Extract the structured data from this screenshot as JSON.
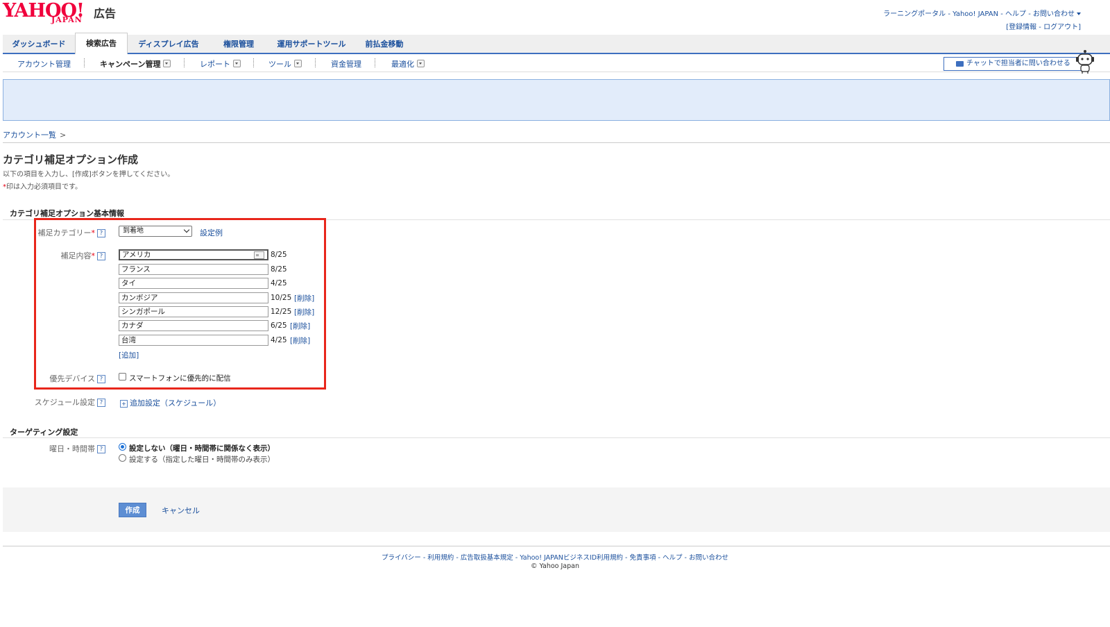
{
  "header": {
    "logo_yahoo": "YAHOO!",
    "logo_japan": "JAPAN",
    "logo_ad": "広告",
    "toplinks": [
      "ラーニングポータル",
      "Yahoo! JAPAN",
      "ヘルプ",
      "お問い合わせ"
    ],
    "account_links": [
      "[登録情報",
      "ログアウト]"
    ],
    "separator": " - "
  },
  "tabs": [
    {
      "label": "ダッシュボード",
      "active": false
    },
    {
      "label": "検索広告",
      "active": true
    },
    {
      "label": "ディスプレイ広告",
      "active": false
    },
    {
      "label": "権限管理",
      "active": false
    },
    {
      "label": "運用サポートツール",
      "active": false
    },
    {
      "label": "前払金移動",
      "active": false
    }
  ],
  "subnav": [
    {
      "label": "アカウント管理"
    },
    {
      "label": "キャンペーン管理"
    },
    {
      "label": "レポート"
    },
    {
      "label": "ツール"
    },
    {
      "label": "資金管理"
    },
    {
      "label": "最適化"
    }
  ],
  "chat_button": "チャットで担当者に問い合わせる",
  "breadcrumb": {
    "item": "アカウント一覧",
    "arrow": ">"
  },
  "page": {
    "title": "カテゴリ補足オプション作成",
    "desc": "以下の項目を入力し、[作成]ボタンを押してください。",
    "required_mark": "*",
    "required_note": "印は入力必須項目です。"
  },
  "basic_section": {
    "title": "カテゴリ補足オプション基本情報",
    "category_label": "補足カテゴリー",
    "category_value": "到着地",
    "example_link": "設定例",
    "content_label": "補足内容",
    "items": [
      {
        "value": "アメリカ",
        "count": "8/25",
        "delete": ""
      },
      {
        "value": "フランス",
        "count": "8/25",
        "delete": ""
      },
      {
        "value": "タイ",
        "count": "4/25",
        "delete": ""
      },
      {
        "value": "カンボジア",
        "count": "10/25",
        "delete": "[削除]"
      },
      {
        "value": "シンガポール",
        "count": "12/25",
        "delete": "[削除]"
      },
      {
        "value": "カナダ",
        "count": "6/25",
        "delete": "[削除]"
      },
      {
        "value": "台湾",
        "count": "4/25",
        "delete": "[削除]"
      }
    ],
    "add_link": "[追加]",
    "device_label": "優先デバイス",
    "device_option": "スマートフォンに優先的に配信",
    "schedule_label": "スケジュール設定",
    "schedule_link": "追加設定（スケジュール）"
  },
  "targeting_section": {
    "title": "ターゲティング設定",
    "dow_label": "曜日・時間帯",
    "option_off": "設定しない（曜日・時間帯に関係なく表示）",
    "option_on": "設定する（指定した曜日・時間帯のみ表示）"
  },
  "actions": {
    "create": "作成",
    "cancel": "キャンセル"
  },
  "footer": {
    "links": [
      "プライバシー",
      "利用規約",
      "広告取扱基本規定",
      "Yahoo! JAPANビジネスID利用規約",
      "免責事項",
      "ヘルプ",
      "お問い合わせ"
    ],
    "copyright": "© Yahoo Japan"
  },
  "colors": {
    "brand": "#f0003c",
    "link": "#1a4f9c",
    "accent": "#3d6fbf",
    "highlight_box": "#e8261b",
    "banner": "#e2ecfa"
  }
}
